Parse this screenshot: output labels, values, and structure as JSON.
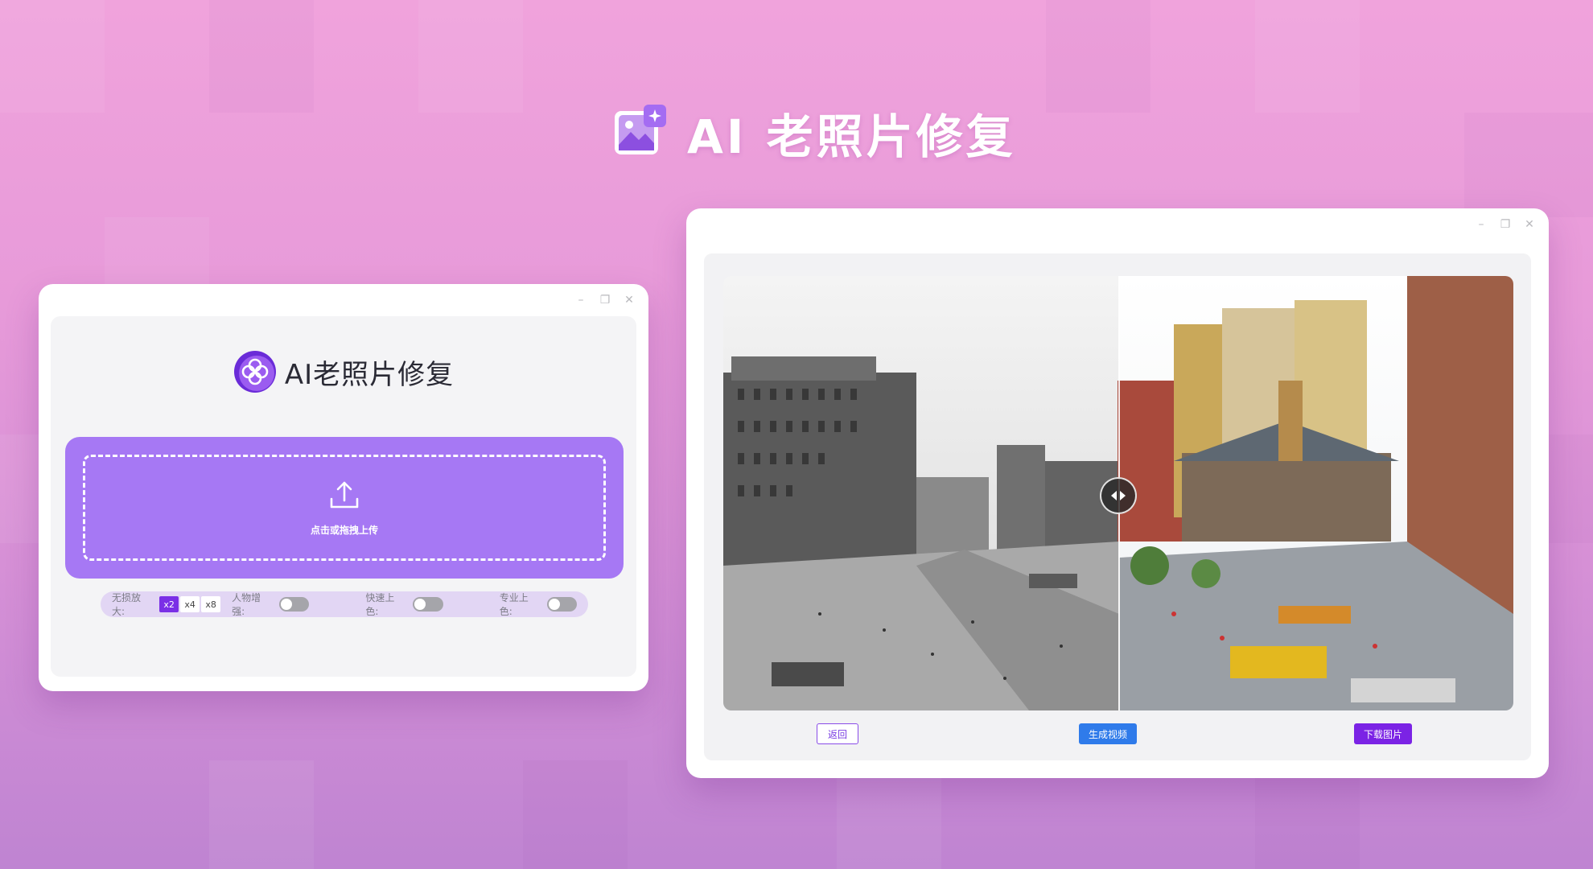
{
  "hero": {
    "title": "AI 老照片修复",
    "icon": "photo-sparkle-icon"
  },
  "left_window": {
    "app_title": "AI老照片修复",
    "logo_icon": "clover-logo-icon",
    "upload": {
      "label": "点击或拖拽上传",
      "icon": "upload-icon"
    },
    "options": {
      "scale_label": "无损放大:",
      "scales": [
        "x2",
        "x4",
        "x8"
      ],
      "scale_selected": "x2",
      "face_enhance_label": "人物增强:",
      "quick_color_label": "快速上色:",
      "pro_color_label": "专业上色:"
    }
  },
  "right_window": {
    "slider_icon": "left-right-arrows-icon",
    "buttons": {
      "back": "返回",
      "video": "生成视频",
      "download": "下载图片"
    }
  },
  "colors": {
    "accent_purple": "#a678f4",
    "download": "#7b23e5",
    "video": "#2f7bea"
  }
}
